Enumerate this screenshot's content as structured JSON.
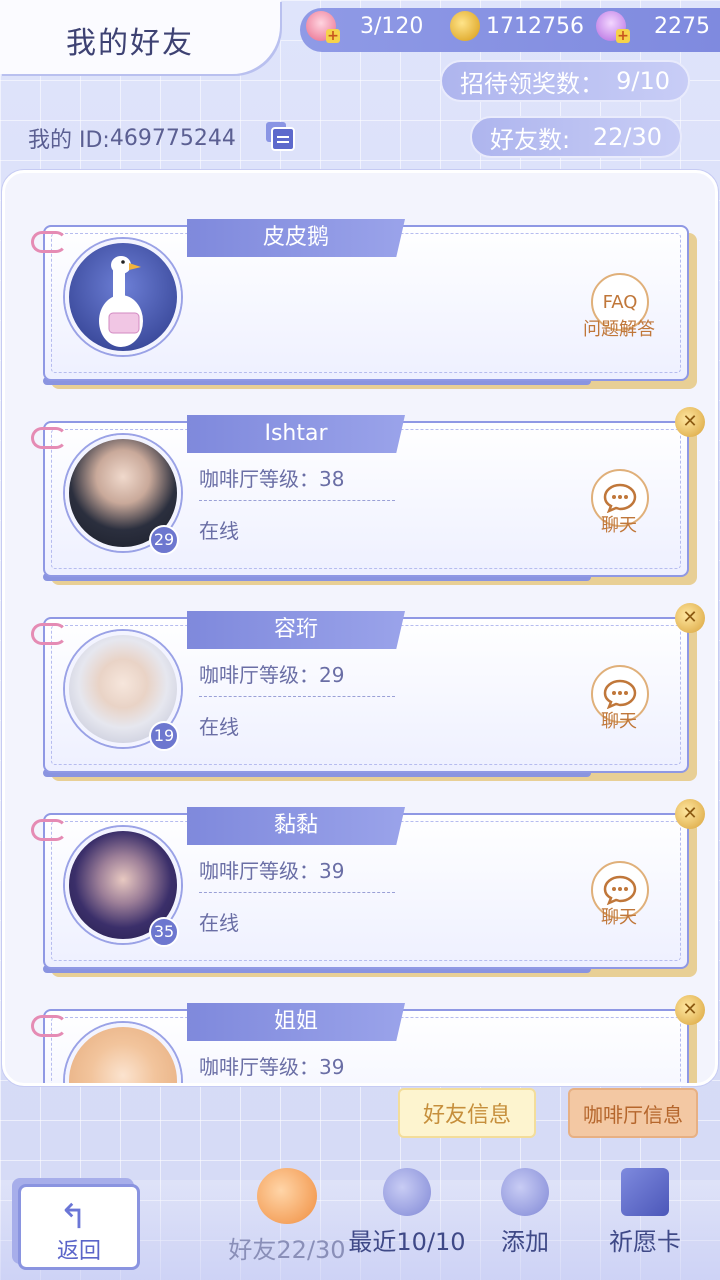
{
  "header": {
    "title": "我的好友",
    "resources": [
      {
        "icon": "cake-icon",
        "value": "3/120"
      },
      {
        "icon": "coin-icon",
        "value": "1712756"
      },
      {
        "icon": "swan-icon",
        "value": "2275"
      }
    ],
    "reception_label": "招待领奖数：",
    "reception_value": "9/10",
    "friends_label": "好友数:",
    "friends_value": "22/30",
    "my_id_label": "我的 ID:",
    "my_id_value": "469775244"
  },
  "friends": [
    {
      "name": "皮皮鹅",
      "avatar": "goose-avatar",
      "action": "FAQ",
      "action_label": "问题解答"
    },
    {
      "name": "Ishtar",
      "level": "29",
      "cafe_label": "咖啡厅等级：",
      "cafe_level": "38",
      "status": "在线",
      "action_label": "聊天"
    },
    {
      "name": "容珩",
      "level": "19",
      "cafe_label": "咖啡厅等级：",
      "cafe_level": "29",
      "status": "在线",
      "action_label": "聊天"
    },
    {
      "name": "黏黏",
      "level": "35",
      "cafe_label": "咖啡厅等级：",
      "cafe_level": "39",
      "status": "在线",
      "action_label": "聊天"
    },
    {
      "name": "姐姐",
      "cafe_label": "咖啡厅等级：",
      "cafe_level": "39"
    }
  ],
  "side_tabs": {
    "friend_info": "好友信息",
    "cafe_info": "咖啡厅信息"
  },
  "bottom_nav": {
    "back": "返回",
    "friends": "好友22/30",
    "recent": "最近10/10",
    "add": "添加",
    "wish": "祈愿卡"
  },
  "colors": {
    "accent": "#7f89dc",
    "gold": "#e8cf95",
    "text_dark": "#3e4273"
  }
}
